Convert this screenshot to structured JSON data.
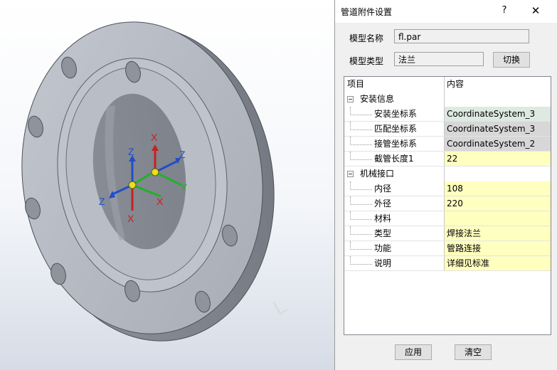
{
  "dialog": {
    "title": "管道附件设置",
    "help": "?",
    "close": "✕",
    "model_name_label": "模型名称",
    "model_name_value": "fl.par",
    "model_type_label": "模型类型",
    "model_type_value": "法兰",
    "switch_button": "切换",
    "apply_button": "应用",
    "clear_button": "清空"
  },
  "grid": {
    "col_item": "项目",
    "col_content": "内容",
    "groups": [
      {
        "name": "安装信息",
        "rows": [
          {
            "name": "安装坐标系",
            "value": "CoordinateSystem_3",
            "bg": "#dde9e1"
          },
          {
            "name": "匹配坐标系",
            "value": "CoordinateSystem_3",
            "bg": "#d7d7d7"
          },
          {
            "name": "接管坐标系",
            "value": "CoordinateSystem_2",
            "bg": "#d7d7d7"
          },
          {
            "name": "截管长度1",
            "value": "22",
            "bg": "#ffffc0"
          }
        ]
      },
      {
        "name": "机械接口",
        "rows": [
          {
            "name": "内径",
            "value": "108",
            "bg": "#ffffc0"
          },
          {
            "name": "外径",
            "value": "220",
            "bg": "#ffffc0"
          },
          {
            "name": "材料",
            "value": "",
            "bg": "#ffffc0"
          },
          {
            "name": "类型",
            "value": "焊接法兰",
            "bg": "#ffffc0"
          },
          {
            "name": "功能",
            "value": "管路连接",
            "bg": "#ffffc0"
          },
          {
            "name": "说明",
            "value": "详细见标准",
            "bg": "#ffffc0"
          }
        ]
      }
    ]
  },
  "viewport": {
    "triad_labels": {
      "z1": "Z",
      "z2": "Z",
      "x1": "X",
      "x2": "X",
      "x3": "X",
      "y1": "Y",
      "z3": "Z"
    },
    "watermark": "L"
  }
}
